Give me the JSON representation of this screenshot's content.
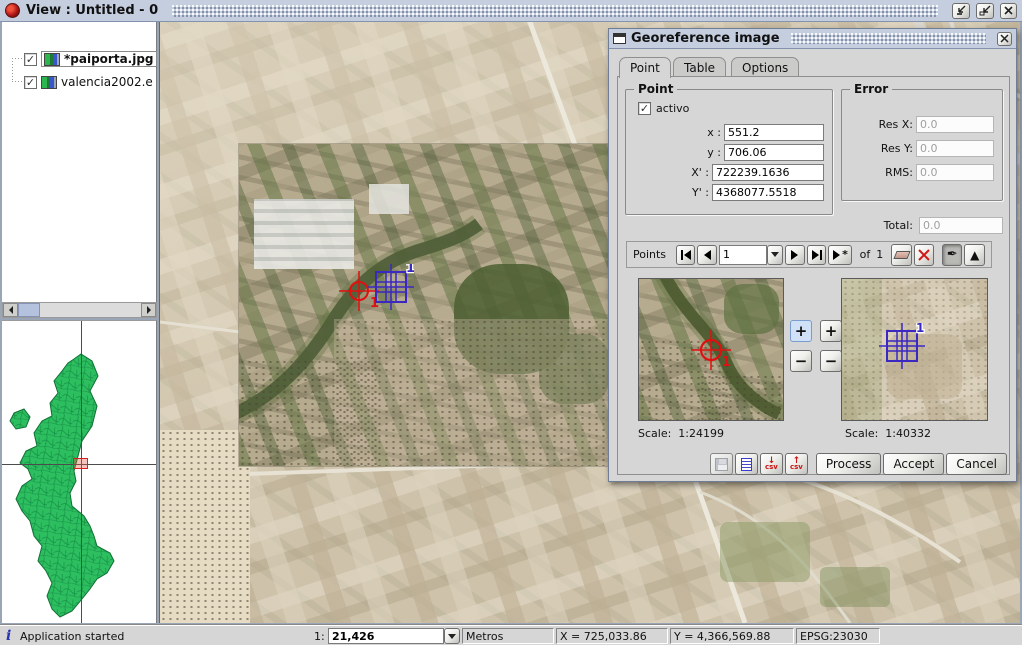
{
  "window": {
    "title": "View : Untitled - 0"
  },
  "toc": {
    "layers": [
      {
        "label": "*paiporta.jpg",
        "checked": true
      },
      {
        "label": "valencia2002.e",
        "checked": true
      }
    ]
  },
  "dialog": {
    "title": "Georeference image",
    "tabs": [
      {
        "label": "Point"
      },
      {
        "label": "Table"
      },
      {
        "label": "Options"
      }
    ],
    "point": {
      "title": "Point",
      "activo": "activo",
      "rows": [
        {
          "label": "x :",
          "value": "551.2"
        },
        {
          "label": "y :",
          "value": "706.06"
        },
        {
          "label": "X' :",
          "value": "722239.1636"
        },
        {
          "label": "Y' :",
          "value": "4368077.5518"
        }
      ]
    },
    "error": {
      "title": "Error",
      "rows": [
        {
          "label": "Res X:",
          "value": "0.0"
        },
        {
          "label": "Res Y:",
          "value": "0.0"
        },
        {
          "label": "RMS:",
          "value": "0.0"
        }
      ],
      "total_label": "Total:",
      "total_value": "0.0"
    },
    "points_nav": {
      "label": "Points",
      "current": "1",
      "of": "of",
      "total": "1"
    },
    "previews": {
      "left_scale": "Scale:  1:24199",
      "right_scale": "Scale:  1:40332",
      "left_marker": "1",
      "right_marker": "1"
    },
    "actions": {
      "process": "Process",
      "accept": "Accept",
      "cancel": "Cancel"
    }
  },
  "map": {
    "red_marker": "1",
    "blue_marker": "1"
  },
  "status": {
    "message": "Application started",
    "scale_label": "1:",
    "scale_value": "21,426",
    "units": "Metros",
    "x": "X = 725,033.86",
    "y": "Y = 4,366,569.88",
    "epsg": "EPSG:23030"
  },
  "colors": {
    "region_green": "#2dbe60",
    "marker_red": "#e01010",
    "marker_blue": "#3a28c0"
  }
}
